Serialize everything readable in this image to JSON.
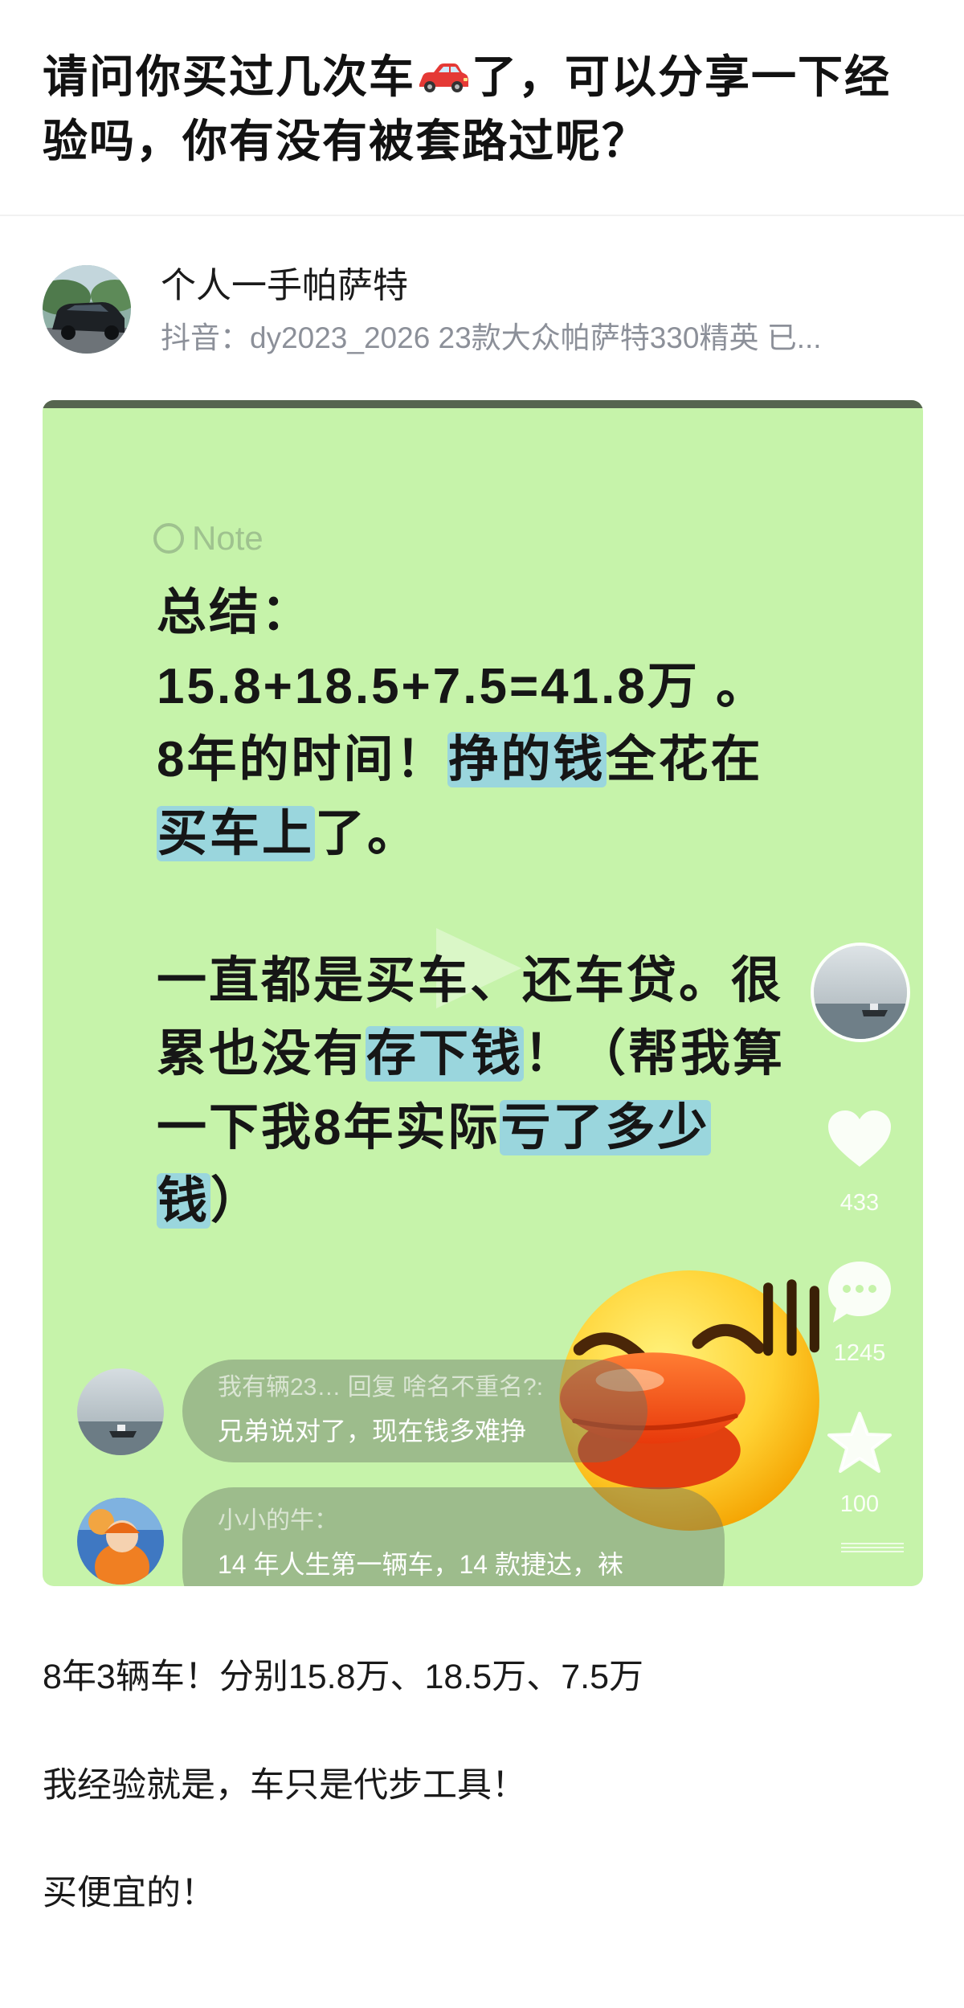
{
  "post": {
    "title_before_icon": "请问你买过几次车",
    "title_icon": "car-icon",
    "title_after_icon": "了，可以分享一下经验吗，你有没有被套路过呢？"
  },
  "author": {
    "avatar_icon": "car-photo-avatar",
    "name": "个人一手帕萨特",
    "bio": "抖音：dy2023_2026 23款大众帕萨特330精英 已..."
  },
  "card": {
    "note_label": "Note",
    "lines": [
      [
        "总结："
      ],
      [
        "15.8+18.5+7.5=41.8万 。"
      ],
      [
        "8年的时间！",
        "挣的钱",
        "全花在"
      ],
      [
        "买车上",
        "了。"
      ],
      [
        "一直都是买车、还车贷。很"
      ],
      [
        "累也没有",
        "存下钱",
        "！（帮我算"
      ],
      [
        "一下我8年实际",
        "亏了多少"
      ],
      [
        "钱",
        "）"
      ]
    ],
    "play_icon": "play-icon",
    "actions": {
      "likes": "433",
      "comments": "1245",
      "favorites": "100"
    },
    "comments": [
      {
        "header": "我有辆23… 回复 啥名不重名?:",
        "text": "兄弟说对了，现在钱多难挣"
      },
      {
        "header": "小小的牛：",
        "text": "14 年人生第一辆车，14 款捷达，袜"
      }
    ],
    "sticker": "duck-face-emoji"
  },
  "body": {
    "paragraphs": [
      "8年3辆车！分别15.8万、18.5万、7.5万",
      "我经验就是，车只是代步工具！",
      "买便宜的！"
    ]
  },
  "colors": {
    "card_background": "#c6f3aa",
    "highlight": "#7dc3ff",
    "secondary_text": "#8c9099",
    "sticker_face": "#ffd233",
    "sticker_beak": "#ff5a1f"
  }
}
